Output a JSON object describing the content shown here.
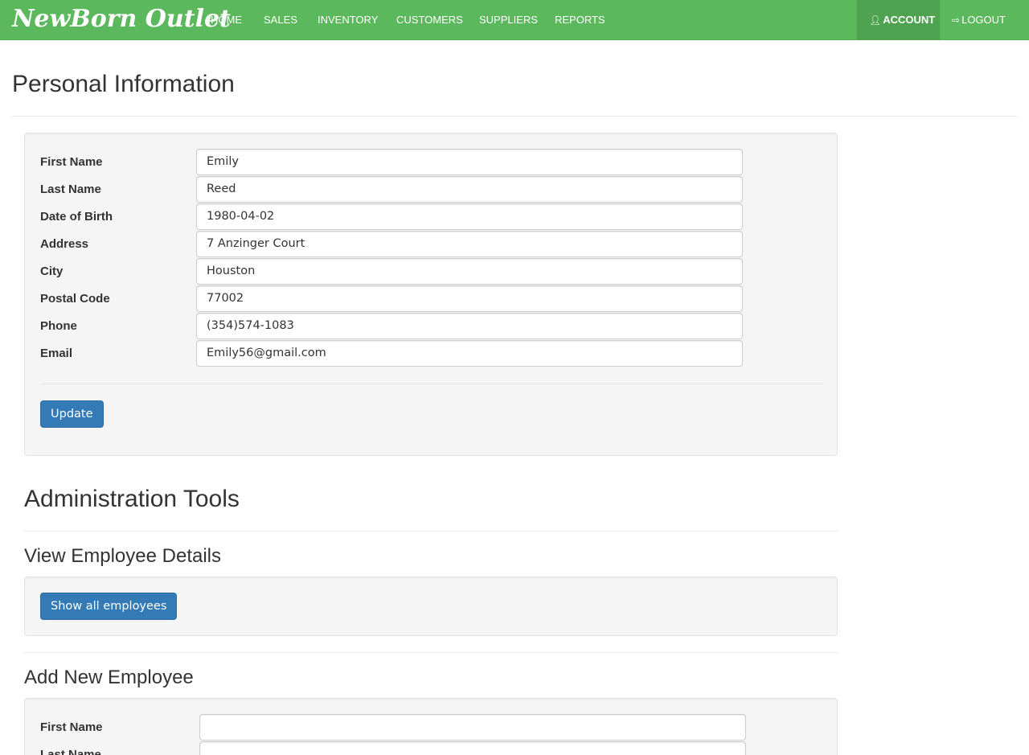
{
  "brand": "NewBorn Outlet",
  "nav": {
    "items": [
      "HOME",
      "SALES",
      "INVENTORY",
      "CUSTOMERS",
      "SUPPLIERS",
      "REPORTS"
    ],
    "account": "ACCOUNT",
    "logout": "LOGOUT"
  },
  "personal": {
    "title": "Personal Information",
    "fields": [
      {
        "label": "First Name",
        "value": "Emily"
      },
      {
        "label": "Last Name",
        "value": "Reed"
      },
      {
        "label": "Date of Birth",
        "value": "1980-04-02"
      },
      {
        "label": "Address",
        "value": "7 Anzinger Court"
      },
      {
        "label": "City",
        "value": "Houston"
      },
      {
        "label": "Postal Code",
        "value": "77002"
      },
      {
        "label": "Phone",
        "value": "(354)574-1083"
      },
      {
        "label": "Email",
        "value": "Emily56@gmail.com"
      }
    ],
    "update_label": "Update"
  },
  "admin": {
    "title": "Administration Tools",
    "view_title": "View Employee Details",
    "show_all_label": "Show all employees",
    "add_title": "Add New Employee",
    "add_fields": [
      {
        "label": "First Name",
        "value": ""
      },
      {
        "label": "Last Name",
        "value": ""
      }
    ]
  },
  "colors": {
    "navbar": "#5cb85c",
    "nav_active": "#4fa24f",
    "primary_button": "#337ab7",
    "well": "#f5f5f5"
  }
}
